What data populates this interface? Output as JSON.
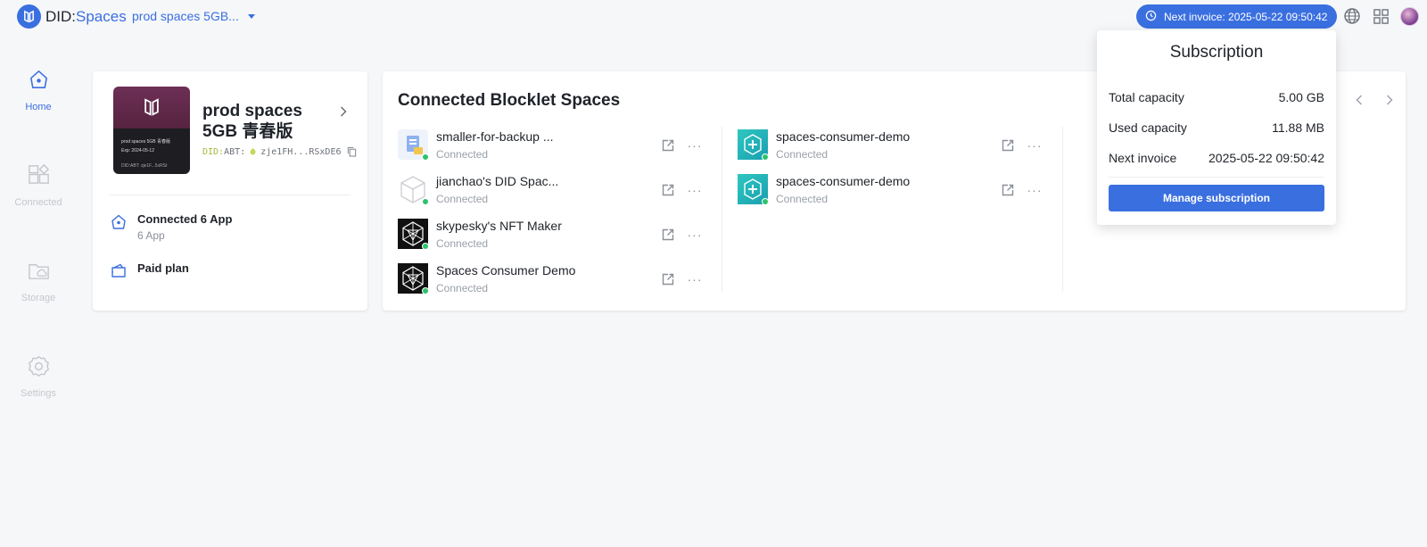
{
  "brand": {
    "name_a": "DID:",
    "name_b": "Spaces"
  },
  "space_selector": {
    "label": "prod spaces 5GB..."
  },
  "header": {
    "invoice_label": "Next invoice: 2025-05-22 09:50:42"
  },
  "nav": {
    "items": [
      {
        "label": "Home",
        "active": true
      },
      {
        "label": "Connected"
      },
      {
        "label": "Storage"
      },
      {
        "label": "Settings"
      }
    ]
  },
  "space_card": {
    "title": "prod spaces 5GB 青春版",
    "did_prefix": "DID:",
    "did_value": "ABT:",
    "did_short": "zje1FH...RSxDE6",
    "cover_name": "prod spaces 5GB 青春版",
    "cover_exp": "Exp: 2024-05-12",
    "cover_did": "DID:ABT: zje1F...5xRSt",
    "connected_title": "Connected 6 App",
    "connected_sub": "6 App",
    "plan_title": "Paid plan"
  },
  "main": {
    "title": "Connected Blocklet Spaces",
    "apps_col1": [
      {
        "name": "smaller-for-backup ...",
        "status": "Connected",
        "icon": "backup-app-icon"
      },
      {
        "name": "jianchao's DID Spac...",
        "status": "Connected",
        "icon": "cube-icon"
      },
      {
        "name": "skypesky's NFT Maker",
        "status": "Connected",
        "icon": "blocklet-icon"
      },
      {
        "name": "Spaces Consumer Demo",
        "status": "Connected",
        "icon": "blocklet-icon"
      }
    ],
    "apps_col2": [
      {
        "name": "spaces-consumer-demo",
        "status": "Connected",
        "icon": "consumer-demo-icon"
      },
      {
        "name": "spaces-consumer-demo",
        "status": "Connected",
        "icon": "consumer-demo-icon"
      }
    ]
  },
  "subscription": {
    "title": "Subscription",
    "rows": [
      {
        "label": "Total capacity",
        "value": "5.00 GB"
      },
      {
        "label": "Used capacity",
        "value": "11.88 MB"
      },
      {
        "label": "Next invoice",
        "value": "2025-05-22 09:50:42"
      }
    ],
    "button": "Manage subscription"
  },
  "colors": {
    "accent": "#3a6fe0",
    "online": "#2dc26b"
  }
}
